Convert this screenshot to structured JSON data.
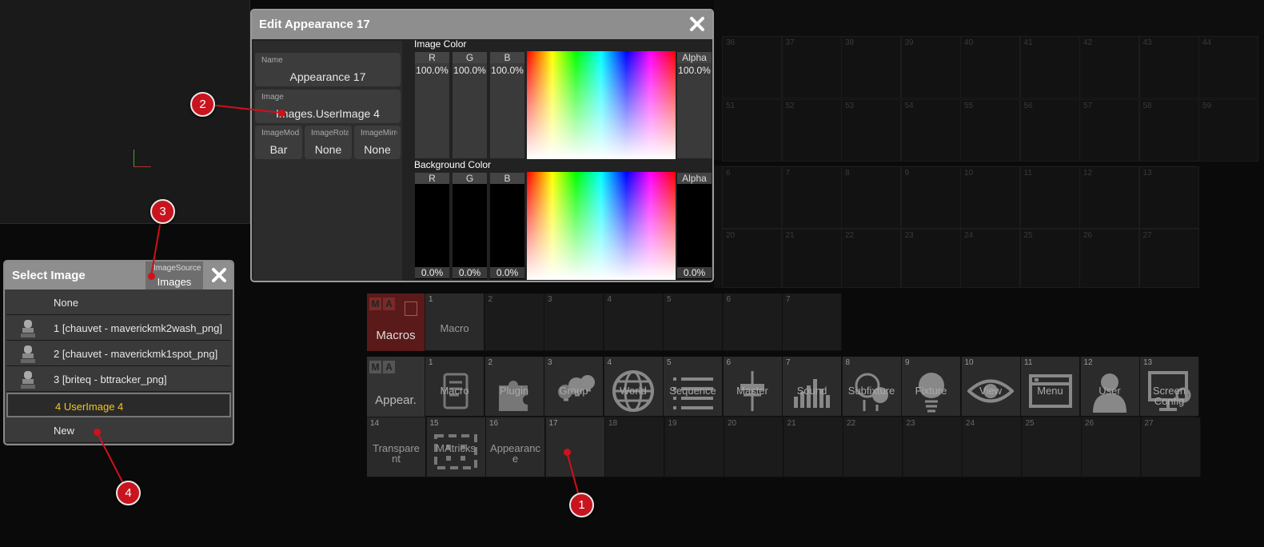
{
  "background_grid": {
    "row1_numbers": [
      "36",
      "37",
      "38",
      "39",
      "40",
      "41",
      "42",
      "43",
      "44"
    ],
    "row2_numbers": [
      "51",
      "52",
      "53",
      "54",
      "55",
      "56",
      "57",
      "58",
      "59"
    ],
    "row3_numbers": [
      "6",
      "7",
      "8",
      "9",
      "10",
      "11",
      "12",
      "13"
    ],
    "row4_numbers": [
      "20",
      "21",
      "22",
      "23",
      "24",
      "25",
      "26",
      "27"
    ]
  },
  "macros_pool": {
    "title": "Macros",
    "ma_letters": [
      "M",
      "A"
    ],
    "cells": [
      {
        "num": "1",
        "label": "Macro"
      },
      {
        "num": "2",
        "label": ""
      },
      {
        "num": "3",
        "label": ""
      },
      {
        "num": "4",
        "label": ""
      },
      {
        "num": "5",
        "label": ""
      },
      {
        "num": "6",
        "label": ""
      },
      {
        "num": "7",
        "label": ""
      }
    ]
  },
  "appearance_pool": {
    "title": "Appear.",
    "ma_letters": [
      "M",
      "A"
    ],
    "row1": [
      {
        "num": "1",
        "label": "Macro",
        "icon": "scroll-icon"
      },
      {
        "num": "2",
        "label": "Plugin",
        "icon": "puzzle-icon"
      },
      {
        "num": "3",
        "label": "Group",
        "icon": "bulbs-icon"
      },
      {
        "num": "4",
        "label": "World",
        "icon": "globe-icon"
      },
      {
        "num": "5",
        "label": "Sequence",
        "icon": "list-icon"
      },
      {
        "num": "6",
        "label": "Master",
        "icon": "fader-icon"
      },
      {
        "num": "7",
        "label": "Sound",
        "icon": "sound-bars-icon"
      },
      {
        "num": "8",
        "label": "Subfixture",
        "icon": "subfixture-icon"
      },
      {
        "num": "9",
        "label": "Fixture",
        "icon": "bulb-icon"
      },
      {
        "num": "10",
        "label": "View",
        "icon": "eye-icon"
      },
      {
        "num": "11",
        "label": "Menu",
        "icon": "window-icon"
      },
      {
        "num": "12",
        "label": "User",
        "icon": "user-icon"
      },
      {
        "num": "13",
        "label": "Screen Config",
        "icon": "screen-config-icon"
      }
    ],
    "row2": [
      {
        "num": "14",
        "label": "Transparent"
      },
      {
        "num": "15",
        "label": "MAtricks"
      },
      {
        "num": "16",
        "label": "Appearance"
      },
      {
        "num": "17",
        "label": ""
      },
      {
        "num": "18",
        "label": ""
      },
      {
        "num": "19",
        "label": ""
      },
      {
        "num": "20",
        "label": ""
      },
      {
        "num": "21",
        "label": ""
      },
      {
        "num": "22",
        "label": ""
      },
      {
        "num": "23",
        "label": ""
      },
      {
        "num": "24",
        "label": ""
      },
      {
        "num": "25",
        "label": ""
      },
      {
        "num": "26",
        "label": ""
      },
      {
        "num": "27",
        "label": ""
      }
    ]
  },
  "edit_dialog": {
    "title": "Edit Appearance 17",
    "name_label": "Name",
    "name_value": "Appearance 17",
    "image_label": "Image",
    "image_value": "Images.UserImage 4",
    "image_mode_label": "ImageMod",
    "image_mode_value": "Bar",
    "image_rotation_label": "ImageRota",
    "image_rotation_value": "None",
    "image_mirror_label": "ImageMirro",
    "image_mirror_value": "None",
    "image_color": {
      "title": "Image Color",
      "r_label": "R",
      "g_label": "G",
      "b_label": "B",
      "alpha_label": "Alpha",
      "r": "100.0%",
      "g": "100.0%",
      "b": "100.0%",
      "alpha": "100.0%"
    },
    "background_color": {
      "title": "Background Color",
      "r_label": "R",
      "g_label": "G",
      "b_label": "B",
      "alpha_label": "Alpha",
      "r": "0.0%",
      "g": "0.0%",
      "b": "0.0%",
      "alpha": "0.0%"
    }
  },
  "select_dialog": {
    "title": "Select Image",
    "source_label": "ImageSource",
    "source_value": "Images",
    "items": [
      {
        "text": "None",
        "thumb": ""
      },
      {
        "text": "1 [chauvet - maverickmk2wash_png]",
        "thumb": "moving-head-icon"
      },
      {
        "text": "2 [chauvet - maverickmk1spot_png]",
        "thumb": "moving-head-icon"
      },
      {
        "text": "3 [briteq - bttracker_png]",
        "thumb": "moving-head-icon"
      },
      {
        "text": "4 UserImage 4",
        "thumb": ""
      },
      {
        "text": "New",
        "thumb": ""
      }
    ],
    "selected_index": 4
  },
  "markers": [
    "1",
    "2",
    "3",
    "4"
  ],
  "colors": {
    "marker": "#c8141e",
    "selected_text": "#f5c518",
    "macro_title_bg": "#5a1a1a",
    "title_bar": "#8e8e8e"
  }
}
